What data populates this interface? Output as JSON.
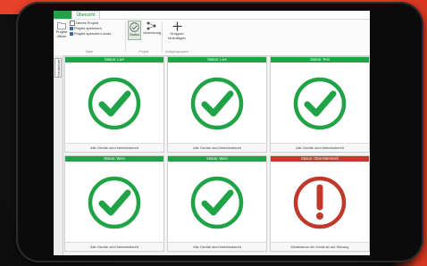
{
  "ribbon": {
    "tab_overview": "Übersicht",
    "buttons": {
      "open_project": "Projekt öffnen",
      "new_project": "Neues Projekt",
      "save_project": "Projekt speichern",
      "save_project_as": "Projekt speichern unter",
      "status": "Status",
      "topology": "Vernetzung",
      "add_group": "Gruppen hinzufügen"
    },
    "groups": {
      "file": "Datei",
      "project": "Projekt",
      "display_groups": "Anlagengruppen"
    }
  },
  "side_tab": {
    "label": "Geräteliste"
  },
  "status_cards": [
    {
      "header": "Status: Live",
      "footer": "Alle Geräte sind betriebsbereit",
      "state": "ok",
      "header_color": "#1fa346",
      "icon": "checkmark-icon"
    },
    {
      "header": "Status: Live",
      "footer": "Alle Geräte sind betriebsbereit",
      "state": "ok",
      "header_color": "#1fa346",
      "icon": "checkmark-icon"
    },
    {
      "header": "Status: Test",
      "footer": "Alle Geräte sind betriebsbereit",
      "state": "ok",
      "header_color": "#1fa346",
      "icon": "checkmark-icon"
    },
    {
      "header": "Status: Wien",
      "footer": "Alle Geräte sind betriebsbereit",
      "state": "ok",
      "header_color": "#1fa346",
      "icon": "checkmark-icon"
    },
    {
      "header": "Status: Wien",
      "footer": "Alle Geräte sind betriebsbereit",
      "state": "ok",
      "header_color": "#1fa346",
      "icon": "checkmark-icon"
    },
    {
      "header": "Status: Oberösterreich",
      "footer": "Mindestens ein Gerät ist auf Störung",
      "state": "error",
      "header_color": "#c0392b",
      "icon": "exclamation-icon"
    }
  ],
  "colors": {
    "ok_green": "#1fa346",
    "error_red": "#c0392b",
    "brand_red": "#e8412c"
  }
}
